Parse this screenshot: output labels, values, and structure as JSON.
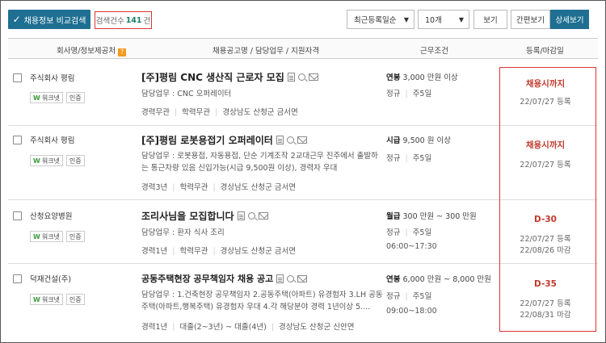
{
  "toolbar": {
    "compare_label": "채용정보 비교검색",
    "count_prefix": "검색건수",
    "count_value": "141",
    "count_suffix": "건",
    "sort_selected": "최근등록일순",
    "size_selected": "10개",
    "view_label": "보기",
    "simple_view_label": "간편보기",
    "detail_view_label": "상세보기",
    "accent_color": "#1f6f92"
  },
  "header": {
    "company": "회사명/정보제공처",
    "title": "채용공고명 / 담당업무 / 지원자격",
    "conditions": "근무조건",
    "dates": "등록/마감일"
  },
  "rows": [
    {
      "company": "주식회사 평림",
      "badge_source": "워크넷",
      "badge_cert": "인증",
      "title": "[주]평림 CNC 생산직 근로자 모집",
      "duty": "담당업무 : CNC 오퍼레이터",
      "career": "경력무관",
      "education": "학력무관",
      "location": "경상남도 산청군 금서면",
      "pay_type": "연봉",
      "pay_amount": "3,000 만원 이상",
      "employment": "정규",
      "workdays": "주5일",
      "hours": "",
      "deadline": "채용시까지",
      "registered": "22/07/27 등록",
      "closing": ""
    },
    {
      "company": "주식회사 평림",
      "badge_source": "워크넷",
      "badge_cert": "인증",
      "title": "[주]평림 로봇용접기 오퍼레이터",
      "duty": "담당업무 : 로봇용접, 자동용접, 단순 기계조작 2교대근무 진주에서 출발하는 통근차량 있음 신입가능(시급 9,500원 이상), 경력자 우대",
      "career": "경력3년",
      "education": "학력무관",
      "location": "경상남도 산청군 금서면",
      "pay_type": "시급",
      "pay_amount": "9,500 원 이상",
      "employment": "정규",
      "workdays": "주5일",
      "hours": "",
      "deadline": "채용시까지",
      "registered": "22/07/27 등록",
      "closing": ""
    },
    {
      "company": "산청요양병원",
      "badge_source": "워크넷",
      "badge_cert": "인증",
      "title": "조리사님을 모집합니다",
      "duty": "담당업무 : 환자 식사 조리",
      "career": "경력1년",
      "education": "학력무관",
      "location": "경상남도 산청군 금서면",
      "pay_type": "월급",
      "pay_amount": "300 만원 ~ 300 만원",
      "employment": "정규",
      "workdays": "주5일",
      "hours": "06:00~17:30",
      "deadline": "D-30",
      "registered": "22/07/27 등록",
      "closing": "22/08/26 마감"
    },
    {
      "company": "덕재건설(주)",
      "badge_source": "워크넷",
      "badge_cert": "인증",
      "title": "공동주택현장 공무책임자 채용 공고",
      "duty": "담당업무 : 1.건축현장 공무책임자 2.공동주택(아파트) 유경험자 3.LH 공동주택(아파트,행복주택) 유경험자 우대 4.각 해당분야 경력 1년이상 5....",
      "career": "경력1년",
      "education": "대졸(2~3년) ~ 대졸(4년)",
      "location": "경상남도 산청군 신안면",
      "pay_type": "연봉",
      "pay_amount": "6,000 만원 ~ 8,000 만원",
      "employment": "정규",
      "workdays": "주5일",
      "hours": "09:00~18:00",
      "deadline": "D-35",
      "registered": "22/07/27 등록",
      "closing": "22/08/31 마감"
    }
  ]
}
